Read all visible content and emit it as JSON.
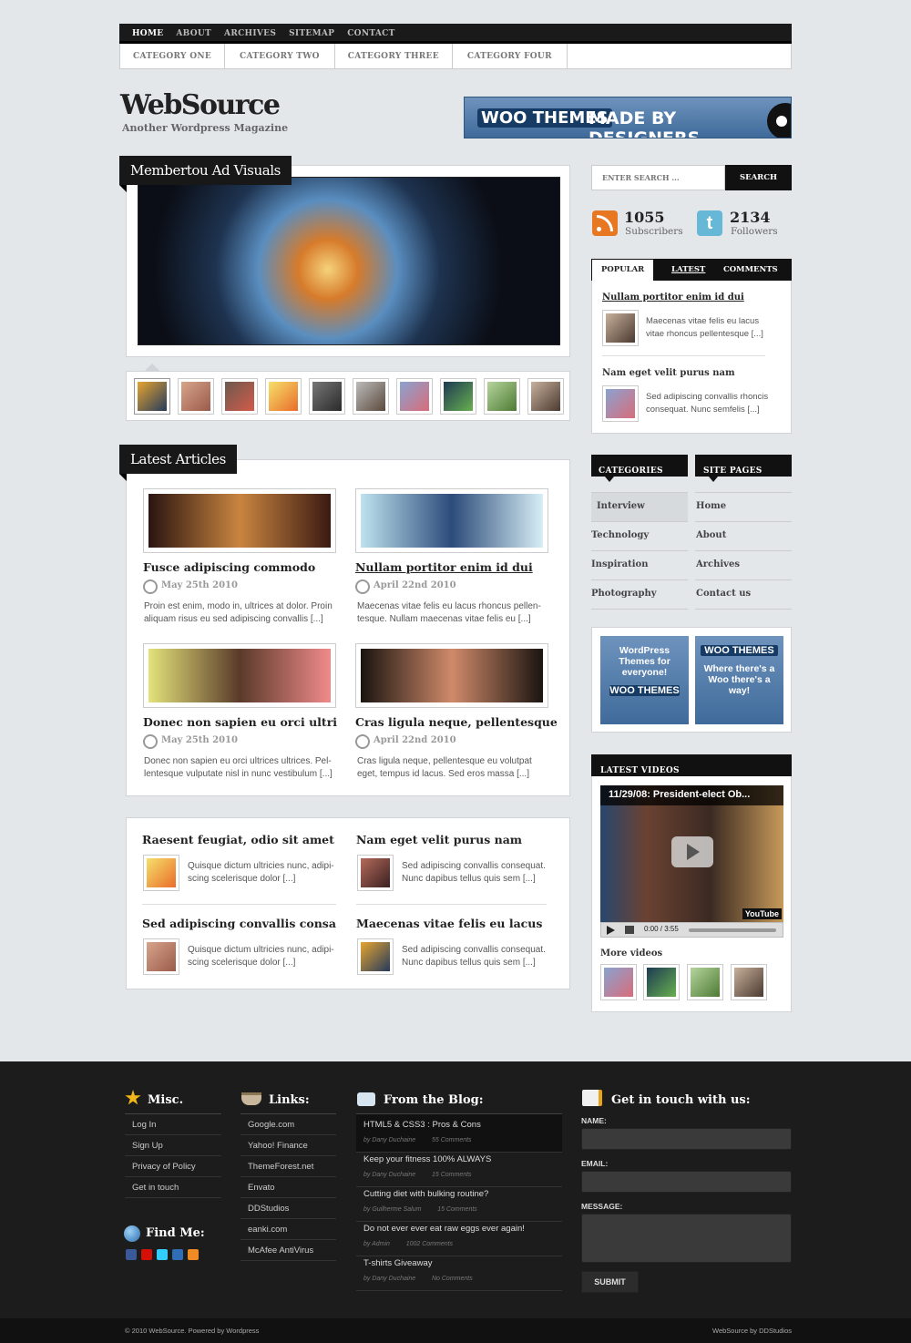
{
  "topnav": [
    "HOME",
    "ABOUT",
    "ARCHIVES",
    "SITEMAP",
    "CONTACT"
  ],
  "catnav": [
    "CATEGORY ONE",
    "CATEGORY TWO",
    "CATEGORY THREE",
    "CATEGORY FOUR"
  ],
  "site": {
    "title": "WebSource",
    "tagline": "Another Wordpress Magazine"
  },
  "banner": {
    "woo": "WOO THEMES",
    "made": "MADE BY DESIGNERS"
  },
  "featured": {
    "title": "Membertou Ad Visuals"
  },
  "latest": {
    "heading": "Latest Articles",
    "articles": [
      {
        "title": "Fusce adipiscing commodo",
        "date": "May 25th 2010",
        "excerpt1": "Proin est enim, modo in, ultrices at dolor. Proin",
        "excerpt2": "aliquam risus eu sed adipiscing convallis [...]"
      },
      {
        "title": "Nullam portitor enim id dui",
        "date": "April 22nd 2010",
        "excerpt1": "Maecenas vitae felis eu lacus rhoncus pellen-",
        "excerpt2": "tesque. Nullam maecenas vitae felis eu [...]"
      },
      {
        "title": "Donec non sapien eu orci ultri",
        "date": "May 25th 2010",
        "excerpt1": "Donec non sapien eu orci ultrices ultrices. Pel-",
        "excerpt2": "lentesque vulputate nisl in nunc vestibulum [...]"
      },
      {
        "title": "Cras ligula neque, pellentesque",
        "date": "April 22nd 2010",
        "excerpt1": "Cras ligula neque, pellentesque eu volutpat",
        "excerpt2": "eget, tempus id lacus. Sed eros massa [...]"
      }
    ]
  },
  "more": [
    {
      "title": "Raesent feugiat, odio sit amet",
      "ex1": "Quisque dictum ultricies nunc, adipi-",
      "ex2": "scing scelerisque dolor [...]"
    },
    {
      "title": "Nam eget velit purus nam",
      "ex1": "Sed adipiscing convallis consequat.",
      "ex2": "Nunc dapibus tellus quis sem [...]"
    },
    {
      "title": "Sed adipiscing convallis consa",
      "ex1": "Quisque dictum ultricies nunc, adipi-",
      "ex2": "scing scelerisque dolor [...]"
    },
    {
      "title": "Maecenas vitae felis eu lacus",
      "ex1": "Sed adipiscing convallis consequat.",
      "ex2": "Nunc dapibus tellus quis sem [...]"
    }
  ],
  "search": {
    "placeholder": "ENTER SEARCH ...",
    "button": "SEARCH"
  },
  "stats": {
    "subs": "1055",
    "subs_label": "Subscribers",
    "followers": "2134",
    "followers_label": "Followers"
  },
  "tabs": {
    "popular": "POPULAR",
    "latest": "LATEST",
    "comments": "COMMENTS",
    "p1_title": "Nullam portitor enim id dui",
    "p1_ex1": "Maecenas vitae felis eu lacus",
    "p1_ex2": "vitae rhoncus pellentesque [...]",
    "p2_title": "Nam eget velit purus nam",
    "p2_ex1": "Sed adipiscing convallis rhoncis",
    "p2_ex2": "consequat. Nunc semfelis [...]"
  },
  "categories": {
    "label": "CATEGORIES",
    "items": [
      "Interview",
      "Technology",
      "Inspiration",
      "Photography"
    ]
  },
  "pages": {
    "label": "SITE PAGES",
    "items": [
      "Home",
      "About",
      "Archives",
      "Contact us"
    ]
  },
  "ads": {
    "a1": "WordPress Themes for everyone!",
    "a1b": "WOO THEMES",
    "a2": "WOO THEMES",
    "a2b": "Where there's a Woo there's a way!"
  },
  "videos": {
    "label": "LATEST VIDEOS",
    "title": "11/29/08: President-elect Ob...",
    "time": "0:00 / 3:55",
    "more": "More videos",
    "yt": "YouTube"
  },
  "footer": {
    "misc": "Misc.",
    "misc_items": [
      "Log In",
      "Sign Up",
      "Privacy of Policy",
      "Get in touch"
    ],
    "links": "Links:",
    "link_items": [
      "Google.com",
      "Yahoo! Finance",
      "ThemeForest.net",
      "Envato",
      "DDStudios",
      "eanki.com",
      "McAfee AntiVirus"
    ],
    "find": "Find Me:",
    "blog": "From the Blog:",
    "blog_items": [
      {
        "t": "HTML5 & CSS3 : Pros & Cons",
        "a": "by Dany Duchaine",
        "c": "55 Comments"
      },
      {
        "t": "Keep your fitness 100% ALWAYS",
        "a": "by Dany Duchaine",
        "c": "15 Comments"
      },
      {
        "t": "Cutting diet with bulking routine?",
        "a": "by Guilherme Salum",
        "c": "15 Comments"
      },
      {
        "t": "Do not ever ever eat raw eggs ever again!",
        "a": "by Admin",
        "c": "1002 Comments"
      },
      {
        "t": "T-shirts Giveaway",
        "a": "by Dany Duchaine",
        "c": "No Comments"
      }
    ],
    "contact": "Get in touch with us:",
    "name": "NAME:",
    "email": "EMAIL:",
    "message": "MESSAGE:",
    "submit": "SUBMIT",
    "copy": "© 2010 WebSource. Powered by Wordpress",
    "credit": "WebSource by DDStudios"
  }
}
